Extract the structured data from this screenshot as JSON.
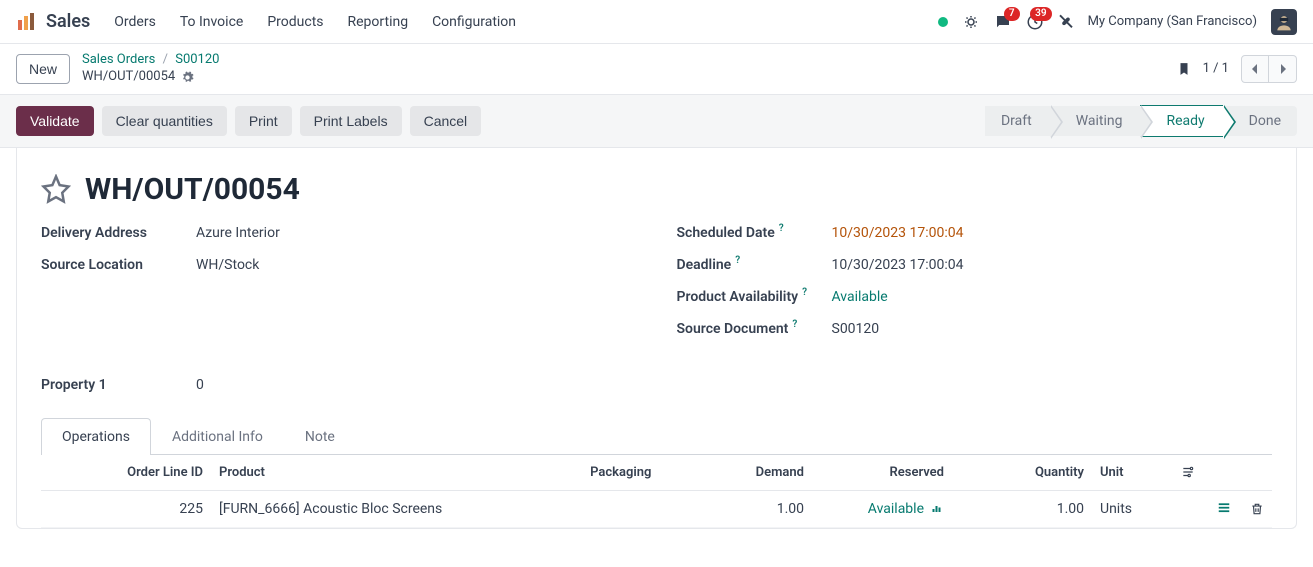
{
  "app": {
    "title": "Sales"
  },
  "nav": {
    "items": [
      "Orders",
      "To Invoice",
      "Products",
      "Reporting",
      "Configuration"
    ]
  },
  "systray": {
    "msg_count": "7",
    "activity_count": "39",
    "company": "My Company (San Francisco)"
  },
  "crumb": {
    "new_label": "New",
    "root": "Sales Orders",
    "parent": "S00120",
    "record": "WH/OUT/00054",
    "pager": "1 / 1"
  },
  "actions": {
    "validate": "Validate",
    "clear": "Clear quantities",
    "print": "Print",
    "print_labels": "Print Labels",
    "cancel": "Cancel"
  },
  "status": {
    "s0": "Draft",
    "s1": "Waiting",
    "s2": "Ready",
    "s3": "Done"
  },
  "record": {
    "title": "WH/OUT/00054"
  },
  "labels": {
    "delivery_address": "Delivery Address",
    "source_location": "Source Location",
    "scheduled_date": "Scheduled Date",
    "deadline": "Deadline",
    "product_availability": "Product Availability",
    "source_document": "Source Document",
    "property1": "Property 1"
  },
  "values": {
    "delivery_address": "Azure Interior",
    "source_location": "WH/Stock",
    "scheduled_date": "10/30/2023 17:00:04",
    "deadline": "10/30/2023 17:00:04",
    "product_availability": "Available",
    "source_document": "S00120",
    "property1": "0"
  },
  "tabs": {
    "t0": "Operations",
    "t1": "Additional Info",
    "t2": "Note"
  },
  "table": {
    "h_order_line": "Order Line ID",
    "h_product": "Product",
    "h_packaging": "Packaging",
    "h_demand": "Demand",
    "h_reserved": "Reserved",
    "h_quantity": "Quantity",
    "h_unit": "Unit",
    "row0": {
      "order_line": "225",
      "product": "[FURN_6666] Acoustic Bloc Screens",
      "packaging": "",
      "demand": "1.00",
      "reserved": "Available",
      "quantity": "1.00",
      "unit": "Units"
    }
  }
}
